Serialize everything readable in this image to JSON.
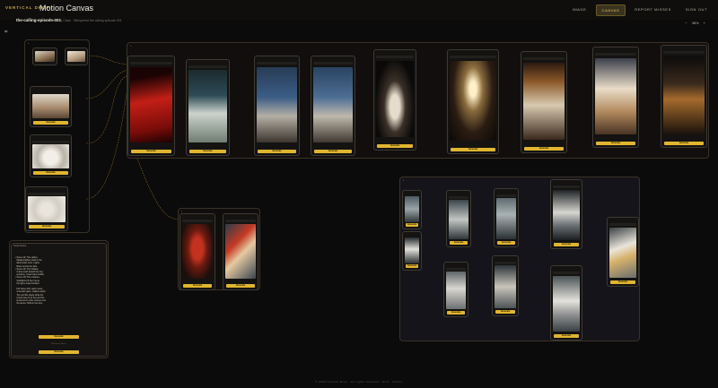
{
  "header": {
    "brand": "VERTICAL DROP",
    "app_title": "Motion Canvas",
    "nav": [
      {
        "label": "IMAGE"
      },
      {
        "label": "CANVAS"
      },
      {
        "label": "REPORT MISSES"
      },
      {
        "label": "SIGN OUT"
      }
    ]
  },
  "subbar": {
    "episode": "the-calling-episode-001",
    "crumb": "Tuesday Class · Whispered the calling episode 001",
    "zoom_minus": "−",
    "zoom_value": "38%",
    "zoom_plus": "+"
  },
  "nodes": {
    "button_label": "Generate",
    "ring_label": "Generate"
  },
  "text_nodes": [
    {
      "title": "Script Notes",
      "body": "• Scene 01: The calling\n  Masked fighter waits in the\n  dark locker room. Lights\n  flicker across the tiles.\n• Scene 02: The hallway\n  A slow push toward the ring\n  entrance, crowd noise builds.\n• Scene 03: The entrance\n  Spotlights hit the ring as\n  the figure steps forward.\n\n  Full frame drift, warm tones,\n  cinematic grain, shallow depth.\n  The veil lifts slowly while the\n  crowd rises to its feet and the\n  announcer's voice echoes over\n  the arena. Hold on the face.",
      "button": "Generate",
      "footer_title": "Reference Notes",
      "footer_button": "Generate"
    }
  ],
  "footer": "© 2025 Vertical Drop · All rights reserved · DLS · LOCAL"
}
